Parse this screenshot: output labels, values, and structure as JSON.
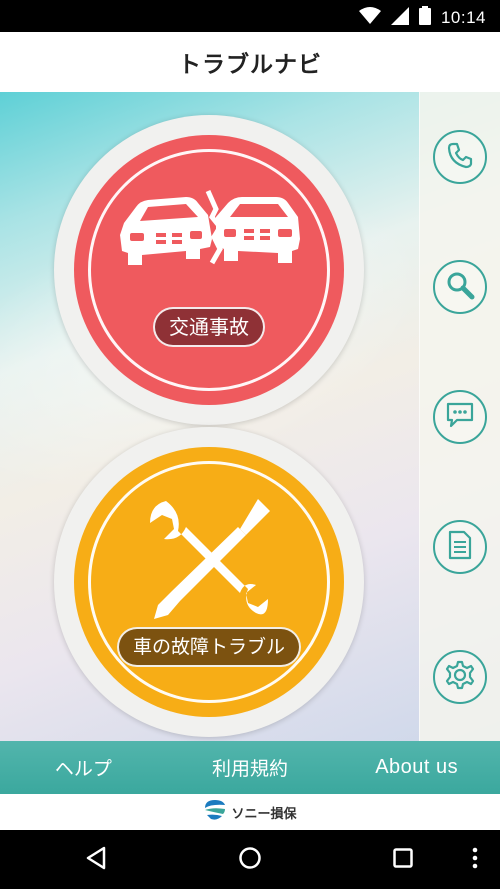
{
  "status_bar": {
    "time": "10:14",
    "icons": [
      "wifi-icon",
      "signal-icon",
      "battery-icon"
    ]
  },
  "header": {
    "title": "トラブルナビ"
  },
  "main": {
    "buttons": [
      {
        "label": "交通事故",
        "icon": "car-crash-icon",
        "color": "#ef5a5e"
      },
      {
        "label": "車の故障トラブル",
        "icon": "wrench-screwdriver-icon",
        "color": "#f7ad16"
      }
    ],
    "side_icons": [
      "phone-icon",
      "search-icon",
      "chat-icon",
      "document-icon",
      "gear-icon"
    ],
    "accent_color": "#3aa59a"
  },
  "bottom_nav": {
    "items": [
      {
        "label": "ヘルプ"
      },
      {
        "label": "利用規約"
      },
      {
        "label": "About us"
      }
    ]
  },
  "brand": {
    "name": "ソニー損保",
    "logo_icon": "sony-sonpo-logo"
  },
  "system_nav": [
    "back-icon",
    "home-icon",
    "recents-icon",
    "more-icon"
  ]
}
